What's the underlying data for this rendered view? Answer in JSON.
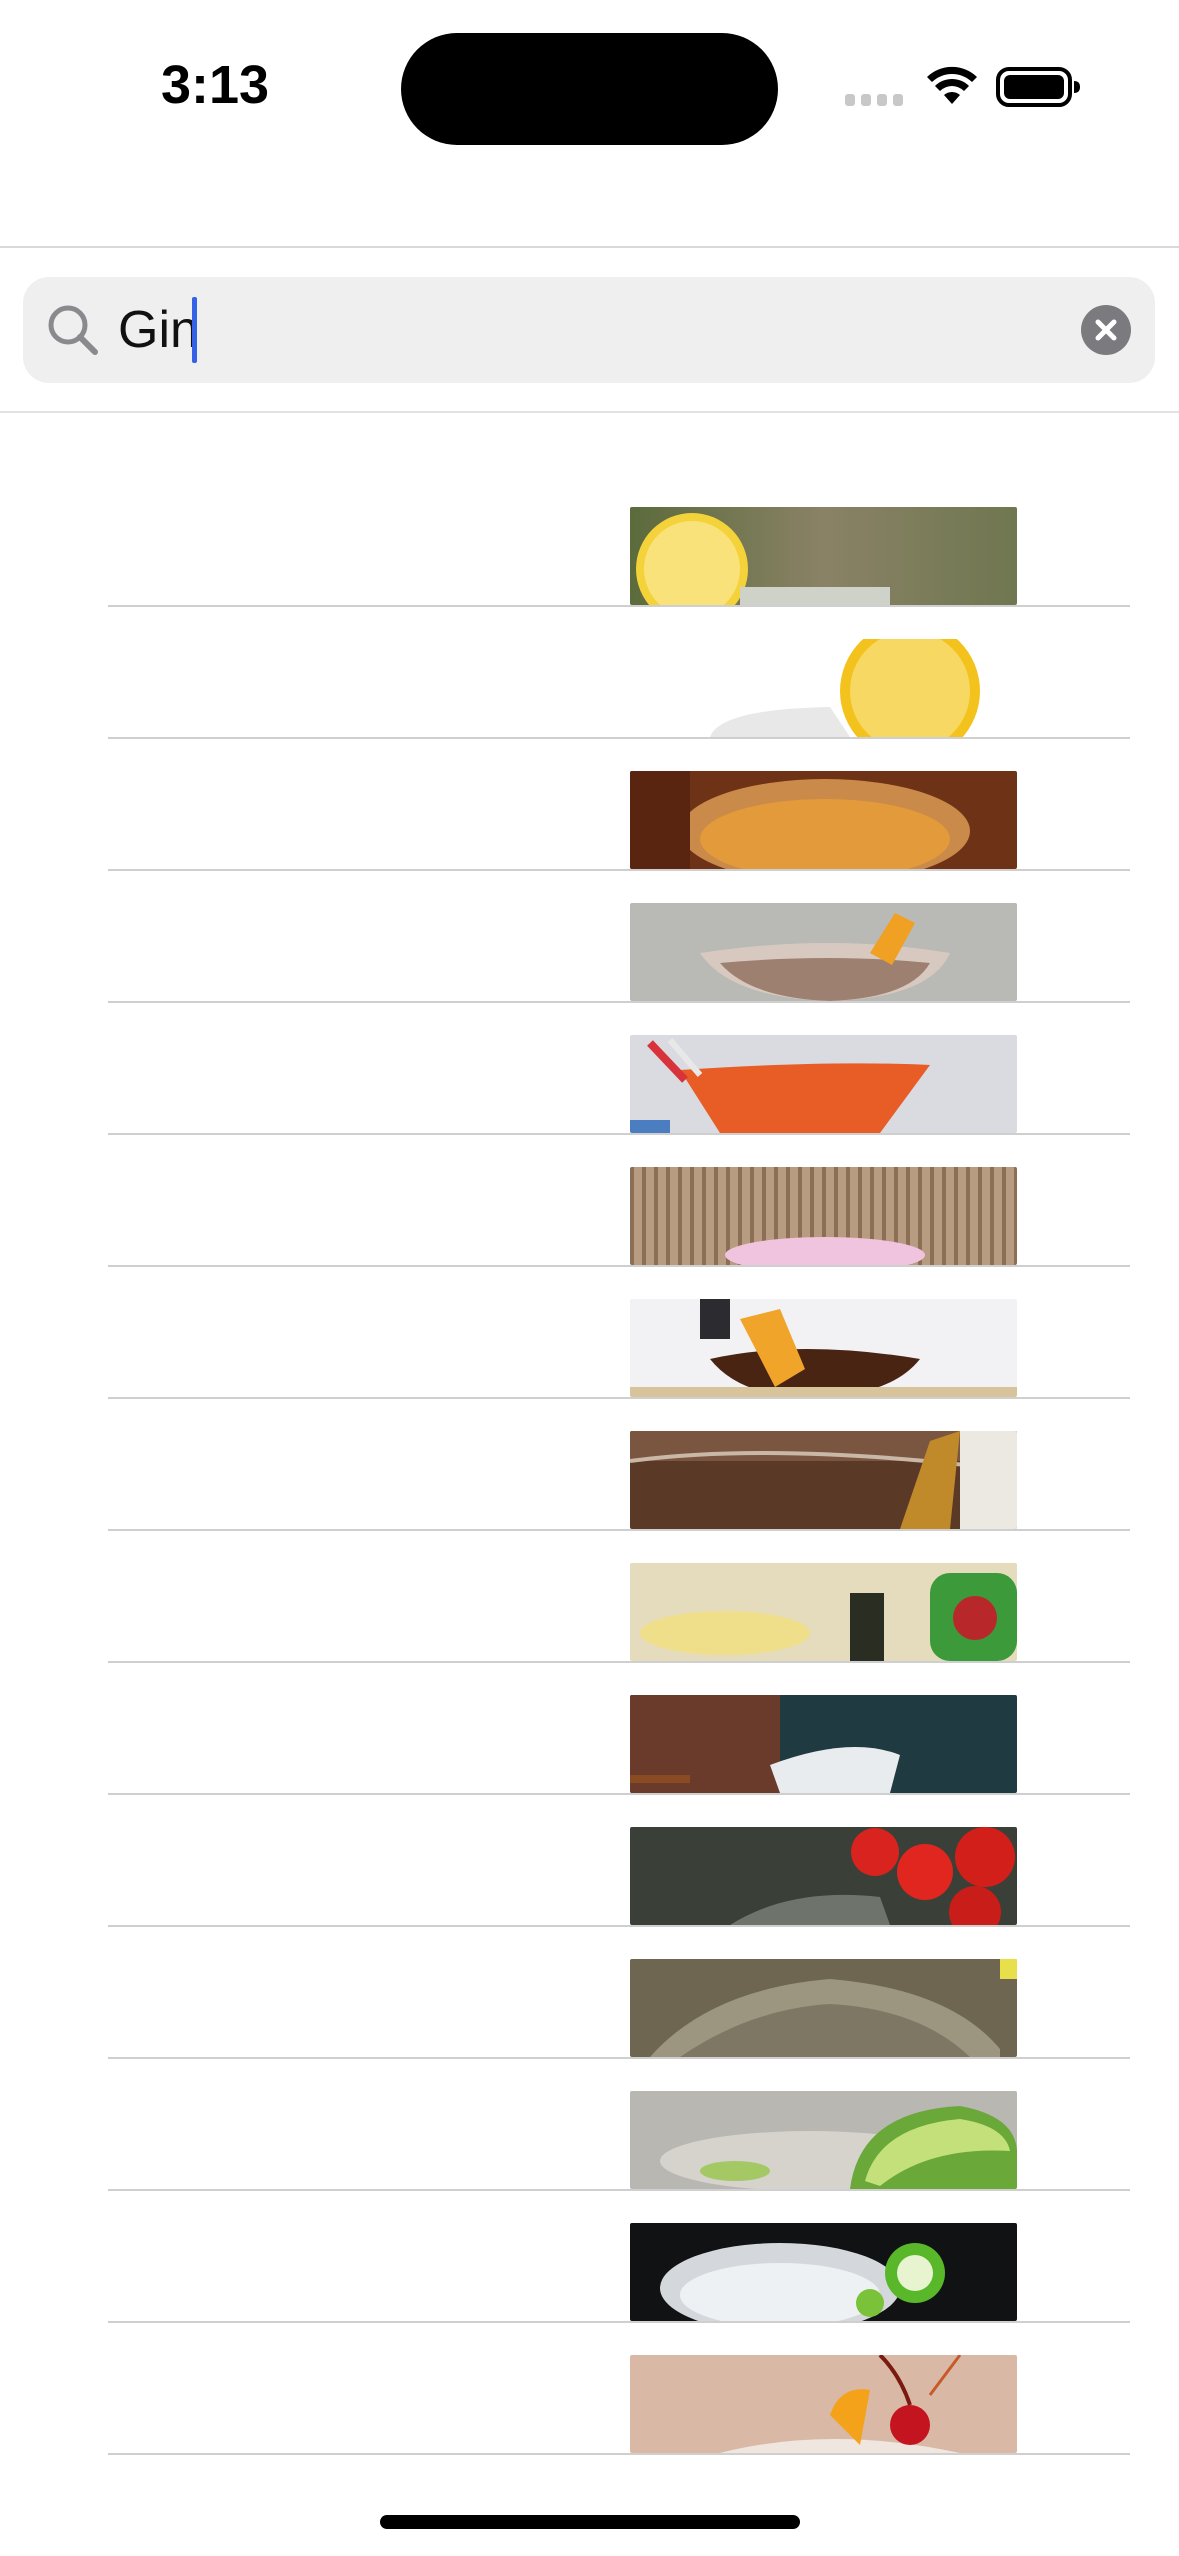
{
  "status_bar": {
    "time": "3:13"
  },
  "search": {
    "query": "Gin",
    "search_icon": "magnifying-glass-icon",
    "clear_icon": "clear-x-icon"
  },
  "results": [
    {
      "title": "",
      "thumbnail": "drink-thumbnail-1"
    },
    {
      "title": "",
      "thumbnail": "drink-thumbnail-2"
    },
    {
      "title": "",
      "thumbnail": "drink-thumbnail-3"
    },
    {
      "title": "",
      "thumbnail": "drink-thumbnail-4"
    },
    {
      "title": "",
      "thumbnail": "drink-thumbnail-5"
    },
    {
      "title": "",
      "thumbnail": "drink-thumbnail-6"
    },
    {
      "title": "",
      "thumbnail": "drink-thumbnail-7"
    },
    {
      "title": "",
      "thumbnail": "drink-thumbnail-8"
    },
    {
      "title": "",
      "thumbnail": "drink-thumbnail-9"
    },
    {
      "title": "",
      "thumbnail": "drink-thumbnail-10"
    },
    {
      "title": "",
      "thumbnail": "drink-thumbnail-11"
    },
    {
      "title": "",
      "thumbnail": "drink-thumbnail-12"
    },
    {
      "title": "",
      "thumbnail": "drink-thumbnail-13"
    },
    {
      "title": "",
      "thumbnail": "drink-thumbnail-14"
    },
    {
      "title": "",
      "thumbnail": "drink-thumbnail-15"
    }
  ],
  "colors": {
    "accent_caret": "#3461e8",
    "search_field_bg": "#efefef",
    "separator": "#cfcfcf"
  }
}
